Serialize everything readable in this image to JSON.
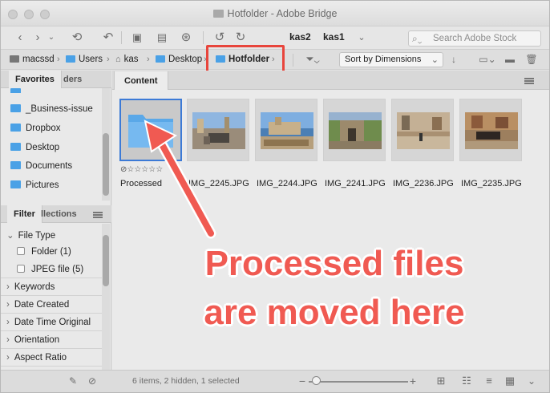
{
  "window": {
    "title": "Hotfolder - Adobe Bridge"
  },
  "toolbar": {
    "workspaces": [
      "kas2",
      "kas1"
    ],
    "search_placeholder": "Search Adobe Stock"
  },
  "path": {
    "items": [
      "macssd",
      "Users",
      "kas",
      "Desktop",
      "Hotfolder"
    ],
    "sort_label": "Sort by Dimensions"
  },
  "favorites": {
    "tab_active": "Favorites",
    "tab_inactive": "ders",
    "items": [
      "_Business-issue",
      "Dropbox",
      "Desktop",
      "Documents",
      "Pictures"
    ]
  },
  "filter": {
    "tab_active": "Filter",
    "tab_inactive": "llections",
    "file_type_label": "File Type",
    "options": [
      {
        "label": "Folder",
        "count": "(1)"
      },
      {
        "label": "JPEG file",
        "count": "(5)"
      }
    ],
    "categories": [
      "Keywords",
      "Date Created",
      "Date Time Original",
      "Orientation",
      "Aspect Ratio"
    ]
  },
  "content": {
    "tab": "Content",
    "items": [
      {
        "name": "Processed",
        "kind": "folder"
      },
      {
        "name": "IMG_2245.JPG",
        "kind": "photo"
      },
      {
        "name": "IMG_2244.JPG",
        "kind": "photo"
      },
      {
        "name": "IMG_2241.JPG",
        "kind": "photo"
      },
      {
        "name": "IMG_2236.JPG",
        "kind": "photo"
      },
      {
        "name": "IMG_2235.JPG",
        "kind": "photo"
      }
    ],
    "rating_stars": "⊘☆☆☆☆☆"
  },
  "status": {
    "text": "6 items, 2 hidden, 1 selected"
  },
  "annotation": {
    "line1": "Processed files",
    "line2": "are moved here",
    "color": "#f05a52"
  }
}
